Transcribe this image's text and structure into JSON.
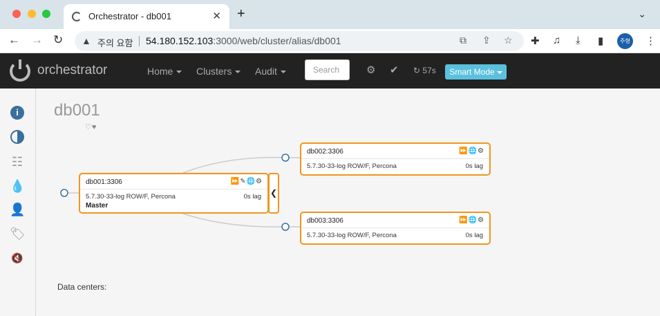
{
  "browser": {
    "tab_title": "Orchestrator - db001",
    "tab_close": "✕",
    "new_tab": "+",
    "tab_menu": "⌄",
    "security_warning": "주의 요함",
    "url_host": "54.180.152.103",
    "url_rest": ":3000/web/cluster/alias/db001",
    "profile_label": "주형",
    "icons": [
      "back-icon",
      "forward-icon",
      "reload-icon",
      "translate-icon",
      "share-icon",
      "star-icon",
      "extensions-icon",
      "media-icon",
      "download-icon",
      "sidepanel-icon",
      "menu-icon"
    ]
  },
  "navbar": {
    "brand": "orchestrator",
    "home": "Home",
    "clusters": "Clusters",
    "audit": "Audit",
    "search_placeholder": "Search",
    "refresh_countdown": "57s",
    "smart_mode": "Smart Mode"
  },
  "sidebar": {
    "items": [
      "info-icon",
      "half-circle-icon",
      "server-icon",
      "drop-icon",
      "user-icon",
      "tag-icon",
      "mute-icon"
    ]
  },
  "page": {
    "title": "db001",
    "favorites": "♡♥",
    "data_centers_label": "Data centers:"
  },
  "topology": {
    "master": {
      "name": "db001:3306",
      "version": "5.7.30-33-log ROW/F, Percona",
      "lag": "0s lag",
      "role": "Master",
      "tools": "⏩✎🌐⚙"
    },
    "replicas": [
      {
        "name": "db002:3306",
        "version": "5.7.30-33-log ROW/F, Percona",
        "lag": "0s lag",
        "tools": "⏩🌐⚙"
      },
      {
        "name": "db003:3306",
        "version": "5.7.30-33-log ROW/F, Percona",
        "lag": "0s lag",
        "tools": "⏩🌐⚙"
      }
    ],
    "collapse_glyph": "❮"
  },
  "colors": {
    "accent": "#f0951e",
    "brand_blue": "#3b6f9c",
    "smart_mode": "#5bc0de",
    "navbar": "#222222"
  }
}
